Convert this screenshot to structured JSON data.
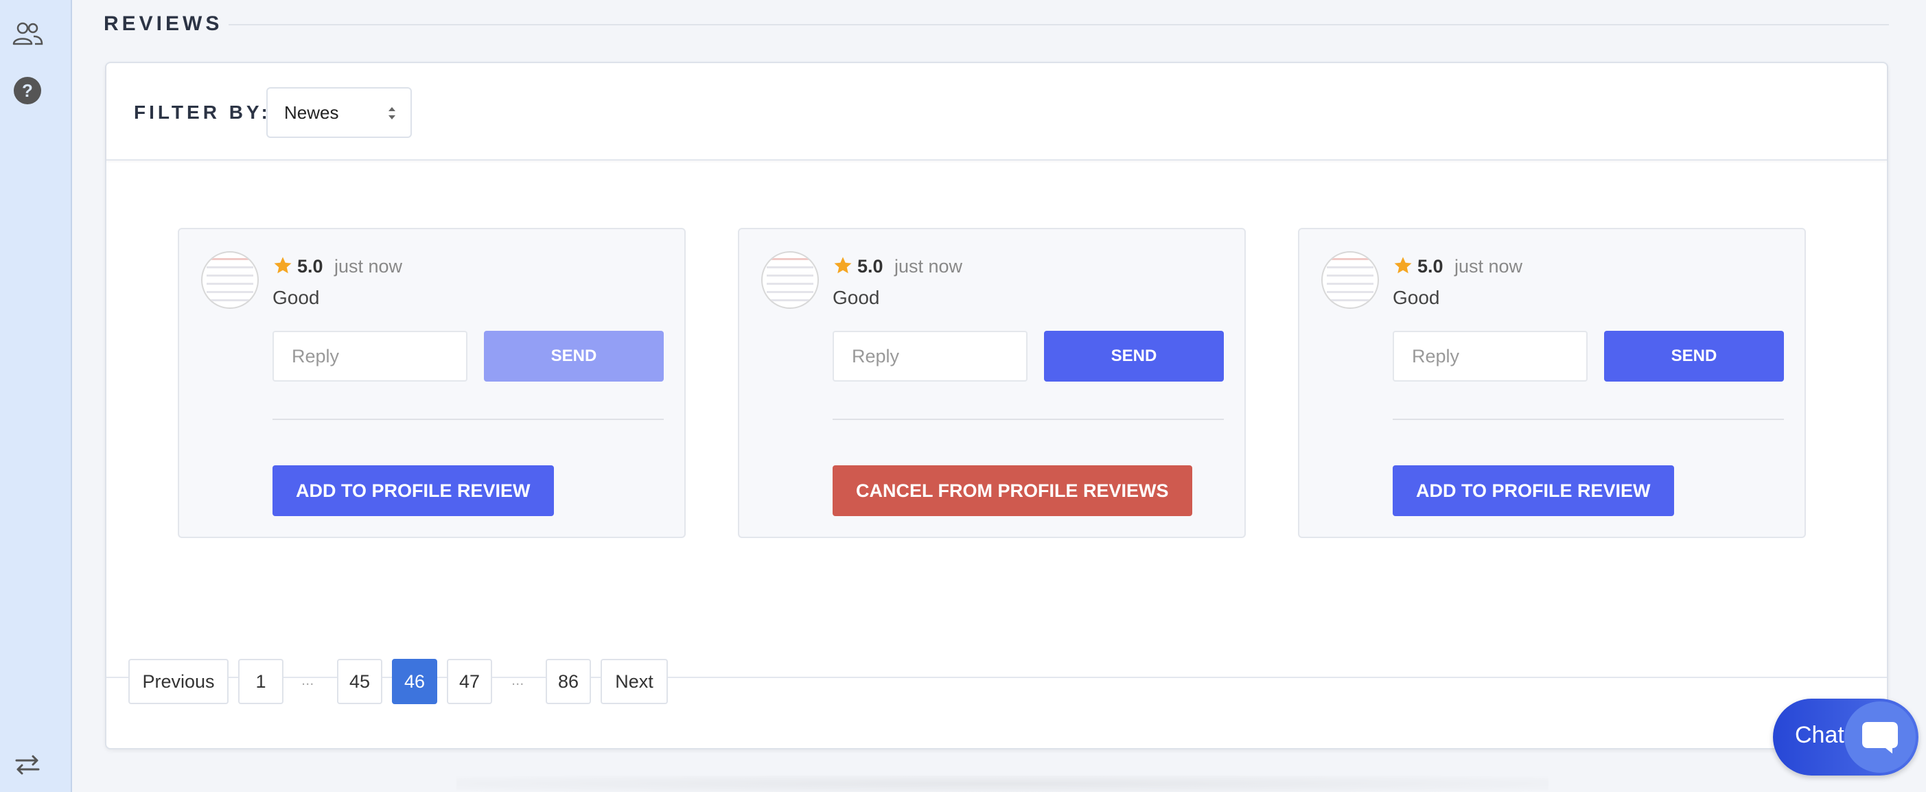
{
  "sidebar": {
    "icons": [
      "users-icon",
      "help-icon",
      "swap-icon"
    ]
  },
  "section": {
    "title": "REVIEWS"
  },
  "filter": {
    "label": "FILTER BY:",
    "selected": "Newes"
  },
  "reviews": [
    {
      "rating": "5.0",
      "time": "just now",
      "comment": "Good",
      "reply_placeholder": "Reply",
      "send_label": "SEND",
      "send_disabled": true,
      "profile_action": "ADD TO PROFILE REVIEW"
    },
    {
      "rating": "5.0",
      "time": "just now",
      "comment": "Good",
      "reply_placeholder": "Reply",
      "send_label": "SEND",
      "send_disabled": false,
      "profile_action": "CANCEL FROM PROFILE REVIEWS"
    },
    {
      "rating": "5.0",
      "time": "just now",
      "comment": "Good",
      "reply_placeholder": "Reply",
      "send_label": "SEND",
      "send_disabled": false,
      "profile_action": "ADD TO PROFILE REVIEW"
    }
  ],
  "pagination": {
    "previous": "Previous",
    "next": "Next",
    "pages": [
      "1",
      "45",
      "46",
      "47",
      "86"
    ],
    "ellipsis": "...",
    "current": "46"
  },
  "chat": {
    "label": "Chat"
  },
  "colors": {
    "primary": "#5063f0",
    "primary_disabled": "#939ff5",
    "danger": "#cf5a4f",
    "page_active": "#3d74dd",
    "star": "#f5a623",
    "sidebar_bg": "#dbe8fb"
  }
}
